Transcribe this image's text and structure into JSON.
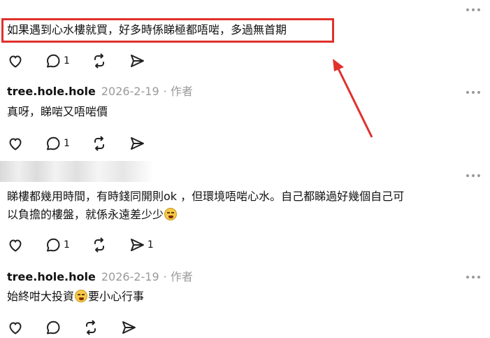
{
  "colors": {
    "highlight": "#e0312c",
    "meta": "#9a9a9a",
    "icon": "#222222"
  },
  "icons": [
    "heart-icon",
    "comment-icon",
    "repost-icon",
    "share-icon",
    "more-icon"
  ],
  "posts": [
    {
      "text": "如果遇到心水樓就買，好多時係睇極都唔啱，多過無首期",
      "actions": {
        "comments": "1"
      }
    },
    {
      "username": "tree.hole.hole",
      "date": "2026-2-19",
      "author_tag": "· 作者",
      "text": "真呀，睇啱又唔啱價",
      "actions": {
        "comments": "1"
      }
    },
    {
      "text_line1": "睇樓都幾用時間，有時錢同開則ok ，但環境唔啱心水。自己都睇過好幾個自己可",
      "text_line2": "以負擔的樓盤，就係永遠差少少",
      "actions": {
        "comments": "1",
        "shares": "1"
      }
    },
    {
      "username": "tree.hole.hole",
      "date": "2026-2-19",
      "author_tag": "· 作者",
      "text_before": "始終咁大投資",
      "text_after": "要小心行事"
    }
  ]
}
